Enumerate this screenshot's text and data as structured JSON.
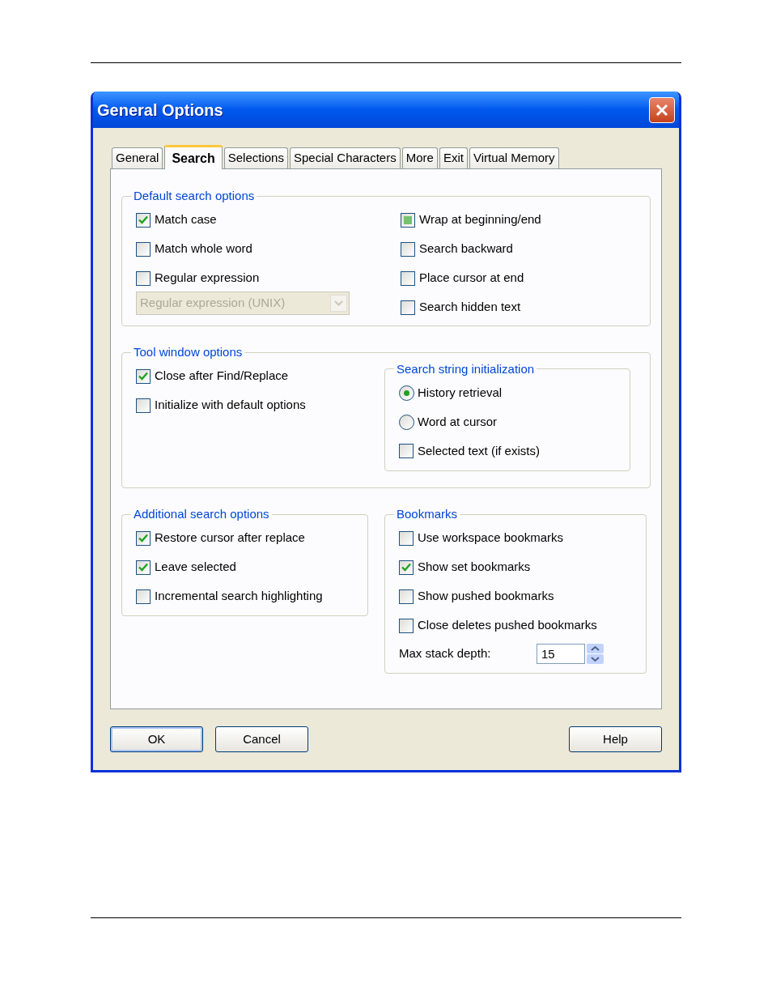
{
  "window": {
    "title": "General Options"
  },
  "tabs": [
    {
      "label": "General",
      "selected": false
    },
    {
      "label": "Search",
      "selected": true
    },
    {
      "label": "Selections",
      "selected": false
    },
    {
      "label": "Special Characters",
      "selected": false
    },
    {
      "label": "More",
      "selected": false
    },
    {
      "label": "Exit",
      "selected": false
    },
    {
      "label": "Virtual Memory",
      "selected": false
    }
  ],
  "default_search_options": {
    "title": "Default search options",
    "left": [
      {
        "label": "Match case",
        "checked": true
      },
      {
        "label": "Match whole word",
        "checked": false
      },
      {
        "label": "Regular expression",
        "checked": false
      }
    ],
    "regex_dropdown": {
      "value": "Regular expression (UNIX)",
      "disabled": true
    },
    "right": [
      {
        "label": "Wrap at beginning/end",
        "checked": true,
        "mixed": true
      },
      {
        "label": "Search backward",
        "checked": false
      },
      {
        "label": "Place cursor at end",
        "checked": false
      },
      {
        "label": "Search hidden text",
        "checked": false
      }
    ]
  },
  "tool_window_options": {
    "title": "Tool window options",
    "checkboxes": [
      {
        "label": "Close after Find/Replace",
        "checked": true
      },
      {
        "label": "Initialize with default options",
        "checked": false
      }
    ],
    "search_string_initialization": {
      "title": "Search string initialization",
      "options": [
        {
          "kind": "radio",
          "label": "History retrieval",
          "selected": true
        },
        {
          "kind": "radio",
          "label": "Word at cursor",
          "selected": false
        },
        {
          "kind": "checkbox",
          "label": "Selected text (if exists)",
          "checked": false
        }
      ]
    }
  },
  "additional_search_options": {
    "title": "Additional search options",
    "checkboxes": [
      {
        "label": "Restore cursor after replace",
        "checked": true
      },
      {
        "label": "Leave selected",
        "checked": true
      },
      {
        "label": "Incremental search highlighting",
        "checked": false
      }
    ]
  },
  "bookmarks": {
    "title": "Bookmarks",
    "checkboxes": [
      {
        "label": "Use workspace bookmarks",
        "checked": false
      },
      {
        "label": "Show set bookmarks",
        "checked": true
      },
      {
        "label": "Show pushed bookmarks",
        "checked": false
      },
      {
        "label": "Close deletes pushed bookmarks",
        "checked": false
      }
    ],
    "max_stack_depth": {
      "label": "Max stack depth:",
      "value": "15"
    }
  },
  "buttons": [
    {
      "label": "OK",
      "default": true
    },
    {
      "label": "Cancel",
      "default": false
    },
    {
      "label": "Help",
      "default": false
    }
  ]
}
